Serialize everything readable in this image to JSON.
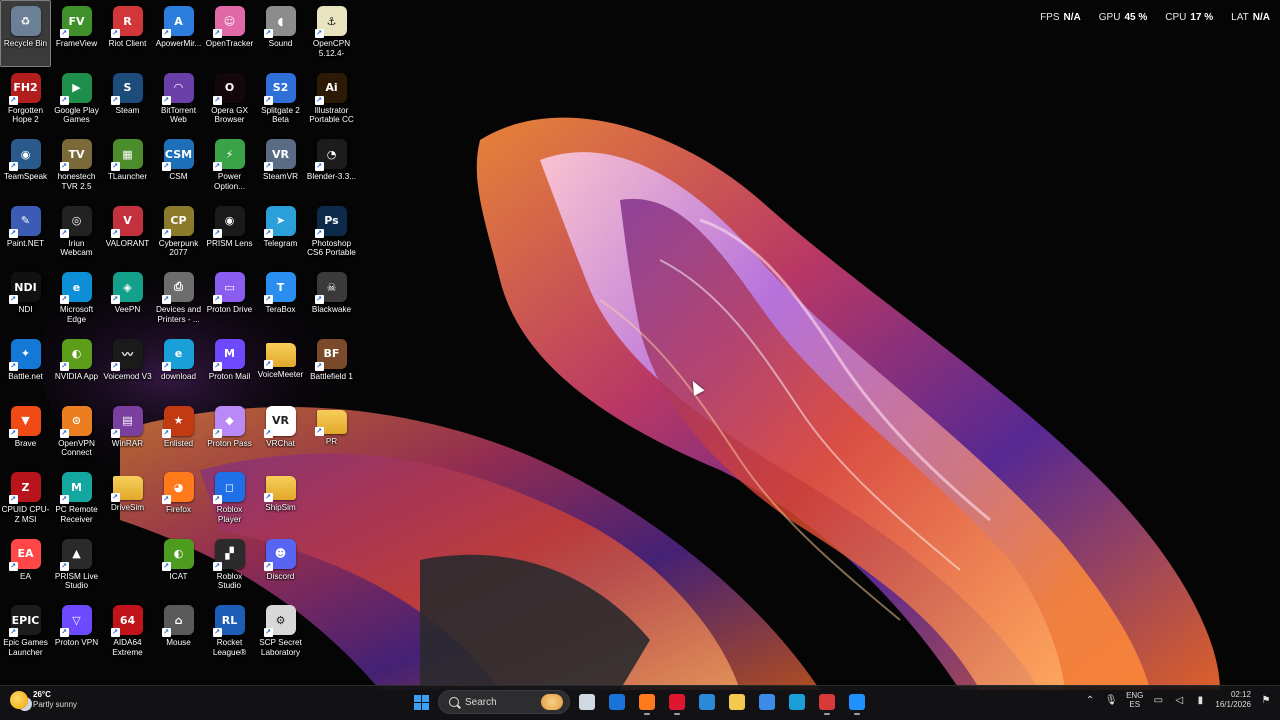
{
  "performance_overlay": [
    {
      "label": "FPS",
      "value": "N/A"
    },
    {
      "label": "GPU",
      "value": "45 %"
    },
    {
      "label": "CPU",
      "value": "17 %"
    },
    {
      "label": "LAT",
      "value": "N/A"
    }
  ],
  "desktop_icons": [
    {
      "label": "Recycle Bin",
      "icon": "recycle-bin-icon",
      "color": "#6b7f96",
      "glyph": "♻",
      "selected": true
    },
    {
      "label": "Forgotten Hope 2",
      "icon": "forgotten-hope-icon",
      "color": "#b21e1e",
      "glyph": "FH2"
    },
    {
      "label": "TeamSpeak",
      "icon": "teamspeak-icon",
      "color": "#2a5a8c",
      "glyph": "◉"
    },
    {
      "label": "Paint.NET",
      "icon": "paintnet-icon",
      "color": "#3b5bb5",
      "glyph": "✎"
    },
    {
      "label": "NDI",
      "icon": "ndi-icon",
      "color": "#111111",
      "glyph": "NDI"
    },
    {
      "label": "Battle.net",
      "icon": "battlenet-icon",
      "color": "#1479d6",
      "glyph": "✦"
    },
    {
      "label": "Brave",
      "icon": "brave-icon",
      "color": "#f04a16",
      "glyph": "▼"
    },
    {
      "label": "CPUID CPU-Z MSI",
      "icon": "cpuz-icon",
      "color": "#b8141b",
      "glyph": "Z"
    },
    {
      "label": "EA",
      "icon": "ea-icon",
      "color": "#ff4747",
      "glyph": "EA"
    },
    {
      "label": "Epic Games Launcher",
      "icon": "epic-games-icon",
      "color": "#1c1c1c",
      "glyph": "EPIC"
    },
    {
      "label": "FrameView",
      "icon": "frameview-icon",
      "color": "#3f8f2a",
      "glyph": "FV"
    },
    {
      "label": "Google Play Games",
      "icon": "google-play-games-icon",
      "color": "#1d8f4a",
      "glyph": "▶"
    },
    {
      "label": "honestech TVR 2.5",
      "icon": "honestech-icon",
      "color": "#7a6a3a",
      "glyph": "TV"
    },
    {
      "label": "Iriun Webcam",
      "icon": "iriun-webcam-icon",
      "color": "#222222",
      "glyph": "◎"
    },
    {
      "label": "Microsoft Edge",
      "icon": "edge-icon",
      "color": "#0c8fd6",
      "glyph": "e"
    },
    {
      "label": "NVIDIA App",
      "icon": "nvidia-app-icon",
      "color": "#5c9e1a",
      "glyph": "◐"
    },
    {
      "label": "OpenVPN Connect",
      "icon": "openvpn-icon",
      "color": "#ea7e20",
      "glyph": "⊙"
    },
    {
      "label": "PC Remote Receiver",
      "icon": "pc-remote-icon",
      "color": "#14a7a0",
      "glyph": "M"
    },
    {
      "label": "PRISM Live Studio",
      "icon": "prism-live-icon",
      "color": "#2a2a2a",
      "glyph": "▲"
    },
    {
      "label": "Proton VPN",
      "icon": "proton-vpn-icon",
      "color": "#6d4aff",
      "glyph": "▽"
    },
    {
      "label": "Riot Client",
      "icon": "riot-client-icon",
      "color": "#d13639",
      "glyph": "R"
    },
    {
      "label": "Steam",
      "icon": "steam-icon",
      "color": "#1b4c7a",
      "glyph": "S"
    },
    {
      "label": "TLauncher",
      "icon": "tlauncher-icon",
      "color": "#4c8c2b",
      "glyph": "▦"
    },
    {
      "label": "VALORANT",
      "icon": "valorant-icon",
      "color": "#c3323c",
      "glyph": "V"
    },
    {
      "label": "VeePN",
      "icon": "veepn-icon",
      "color": "#13a18c",
      "glyph": "◈"
    },
    {
      "label": "Voicemod V3",
      "icon": "voicemod-icon",
      "color": "#1a1a1a",
      "glyph": "〰"
    },
    {
      "label": "WinRAR",
      "icon": "winrar-icon",
      "color": "#7b3fa0",
      "glyph": "▤"
    },
    {
      "label": "DriveSim",
      "icon": "folder-icon",
      "color": "#e8b93a",
      "glyph": ""
    },
    {
      "label": "PRISM Live Studio",
      "icon": "hidden",
      "color": "transparent",
      "glyph": "",
      "hidden": true
    },
    {
      "label": "AIDA64 Extreme",
      "icon": "aida64-icon",
      "color": "#c0141a",
      "glyph": "64"
    },
    {
      "label": "ApowerMir...",
      "icon": "apowermirror-icon",
      "color": "#2c7ddc",
      "glyph": "A"
    },
    {
      "label": "BitTorrent Web",
      "icon": "bittorrent-icon",
      "color": "#6a3fa8",
      "glyph": "◠"
    },
    {
      "label": "CSM",
      "icon": "csm-icon",
      "color": "#1d6fb8",
      "glyph": "CSM"
    },
    {
      "label": "Cyberpunk 2077",
      "icon": "cyberpunk-icon",
      "color": "#8a7a2a",
      "glyph": "CP"
    },
    {
      "label": "Devices and Printers - ...",
      "icon": "devices-printers-icon",
      "color": "#6d6d6d",
      "glyph": "⎙"
    },
    {
      "label": "download",
      "icon": "edge-download-icon",
      "color": "#19a0d8",
      "glyph": "e"
    },
    {
      "label": "Enlisted",
      "icon": "enlisted-icon",
      "color": "#c23a12",
      "glyph": "★"
    },
    {
      "label": "Firefox",
      "icon": "firefox-icon",
      "color": "#ff7a1a",
      "glyph": "◕"
    },
    {
      "label": "ICAT",
      "icon": "icat-icon",
      "color": "#4d9b1f",
      "glyph": "◐"
    },
    {
      "label": "Mouse",
      "icon": "mouse-icon",
      "color": "#5a5a5a",
      "glyph": "⌂"
    },
    {
      "label": "OpenTracker",
      "icon": "opentracker-icon",
      "color": "#e06aa8",
      "glyph": "☺"
    },
    {
      "label": "Opera GX Browser",
      "icon": "opera-gx-icon",
      "color": "#14070a",
      "glyph": "O"
    },
    {
      "label": "Power Option...",
      "icon": "power-options-icon",
      "color": "#3aa347",
      "glyph": "⚡"
    },
    {
      "label": "PRISM Lens",
      "icon": "prism-lens-icon",
      "color": "#1a1a1a",
      "glyph": "◉"
    },
    {
      "label": "Proton Drive",
      "icon": "proton-drive-icon",
      "color": "#8a5cf0",
      "glyph": "▭"
    },
    {
      "label": "Proton Mail",
      "icon": "proton-mail-icon",
      "color": "#6d4aff",
      "glyph": "M"
    },
    {
      "label": "Proton Pass",
      "icon": "proton-pass-icon",
      "color": "#b98af7",
      "glyph": "◆"
    },
    {
      "label": "Roblox Player",
      "icon": "roblox-player-icon",
      "color": "#1f6fe8",
      "glyph": "◻"
    },
    {
      "label": "Roblox Studio",
      "icon": "roblox-studio-icon",
      "color": "#2b2b2b",
      "glyph": "▞"
    },
    {
      "label": "Rocket League®",
      "icon": "rocket-league-icon",
      "color": "#1c5db8",
      "glyph": "RL"
    },
    {
      "label": "Sound",
      "icon": "sound-icon",
      "color": "#8c8c8c",
      "glyph": "◖"
    },
    {
      "label": "Splitgate 2 Beta",
      "icon": "splitgate-icon",
      "color": "#2f6fd8",
      "glyph": "S2"
    },
    {
      "label": "SteamVR",
      "icon": "steamvr-icon",
      "color": "#5a6b86",
      "glyph": "VR"
    },
    {
      "label": "Telegram",
      "icon": "telegram-icon",
      "color": "#2a9fd8",
      "glyph": "➤"
    },
    {
      "label": "TeraBox",
      "icon": "terabox-icon",
      "color": "#2a8ef0",
      "glyph": "T"
    },
    {
      "label": "VoiceMeeter",
      "icon": "folder-icon",
      "color": "#e8b93a",
      "glyph": ""
    },
    {
      "label": "VRChat",
      "icon": "vrchat-icon",
      "color": "#ffffff",
      "glyph": "VR",
      "dark": true
    },
    {
      "label": "ShipSim",
      "icon": "folder-icon",
      "color": "#e8b93a",
      "glyph": ""
    },
    {
      "label": "Discord",
      "icon": "discord-icon",
      "color": "#5865f2",
      "glyph": "☻"
    },
    {
      "label": "SCP Secret Laboratory",
      "icon": "scp-icon",
      "color": "#d8d8d8",
      "glyph": "⚙",
      "dark": true
    },
    {
      "label": "OpenCPN 5.12.4-0+37...",
      "icon": "opencpn-icon",
      "color": "#e8e4c0",
      "glyph": "⚓",
      "dark": true
    },
    {
      "label": "Illustrator Portable CC",
      "icon": "illustrator-icon",
      "color": "#2c1a06",
      "glyph": "Ai"
    },
    {
      "label": "Blender-3.3...",
      "icon": "blender-icon",
      "color": "#1c1c1c",
      "glyph": "◔"
    },
    {
      "label": "Photoshop CS6 Portable",
      "icon": "photoshop-icon",
      "color": "#0d2a4a",
      "glyph": "Ps"
    },
    {
      "label": "Blackwake",
      "icon": "blackwake-icon",
      "color": "#3a3a3a",
      "glyph": "☠"
    },
    {
      "label": "Battlefield 1",
      "icon": "battlefield-icon",
      "color": "#7a4a2a",
      "glyph": "BF"
    },
    {
      "label": "PR",
      "icon": "folder-icon",
      "color": "#e8b93a",
      "glyph": ""
    },
    {
      "label": "",
      "icon": "hidden",
      "color": "transparent",
      "glyph": "",
      "hidden": true
    },
    {
      "label": "",
      "icon": "hidden",
      "color": "transparent",
      "glyph": "",
      "hidden": true
    },
    {
      "label": "",
      "icon": "hidden",
      "color": "transparent",
      "glyph": "",
      "hidden": true
    }
  ],
  "taskbar": {
    "weather": {
      "temp": "26°C",
      "condition": "Partly sunny"
    },
    "search_placeholder": "Search",
    "apps": [
      {
        "name": "task-view-icon",
        "color": "#cfd8e3",
        "running": false
      },
      {
        "name": "outlook-icon",
        "color": "#1a73d9",
        "running": false
      },
      {
        "name": "firefox-taskbar-icon",
        "color": "#ff7a1a",
        "running": true
      },
      {
        "name": "opera-gx-taskbar-icon",
        "color": "#e0152f",
        "running": true
      },
      {
        "name": "mail-icon",
        "color": "#2b8ad8",
        "running": false
      },
      {
        "name": "file-explorer-icon",
        "color": "#f2c94c",
        "running": false
      },
      {
        "name": "microsoft-store-icon",
        "color": "#3d8be8",
        "running": false
      },
      {
        "name": "edge-taskbar-icon",
        "color": "#19a0d8",
        "running": false
      },
      {
        "name": "snipping-tool-icon",
        "color": "#d83a3a",
        "running": true
      },
      {
        "name": "photos-icon",
        "color": "#1e90ff",
        "running": true
      }
    ],
    "language": {
      "line1": "ENG",
      "line2": "ES"
    },
    "time": "02:12",
    "date": "16/1/2026"
  }
}
